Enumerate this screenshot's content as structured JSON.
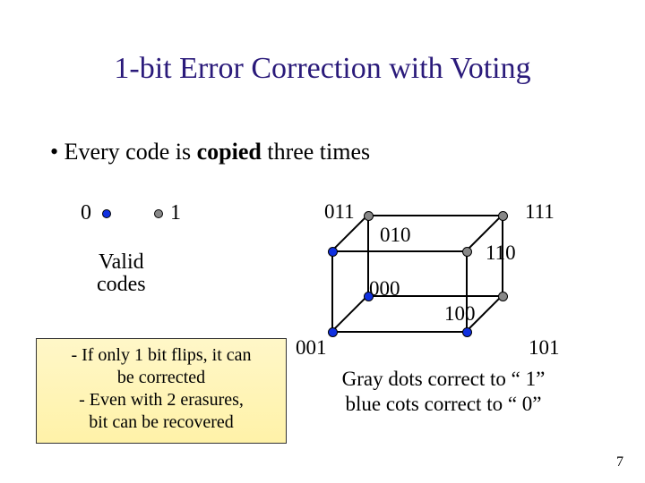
{
  "title": "1-bit Error Correction with Voting",
  "bullet_prefix": "•  Every code is ",
  "bullet_bold": "copied",
  "bullet_suffix": " three times",
  "valid": {
    "zero": "0",
    "one": "1",
    "zero_dot_color": "blue",
    "one_dot_color": "gray",
    "label_line1": "Valid",
    "label_line2": "codes"
  },
  "note": {
    "line1": "- If only 1 bit flips, it can",
    "line2": "be corrected",
    "line3": "- Even with 2 erasures,",
    "line4": "bit can be recovered"
  },
  "cube": {
    "v000": "000",
    "v001": "001",
    "v010": "010",
    "v011": "011",
    "v100": "100",
    "v101": "101",
    "v110": "110",
    "v111": "111",
    "color_000": "blue",
    "color_001": "blue",
    "color_010": "blue",
    "color_011": "gray",
    "color_100": "blue",
    "color_101": "gray",
    "color_110": "gray",
    "color_111": "gray"
  },
  "explain": {
    "line1": "Gray dots correct to “ 1”",
    "line2": "blue cots correct to “ 0”"
  },
  "page_number": "7"
}
